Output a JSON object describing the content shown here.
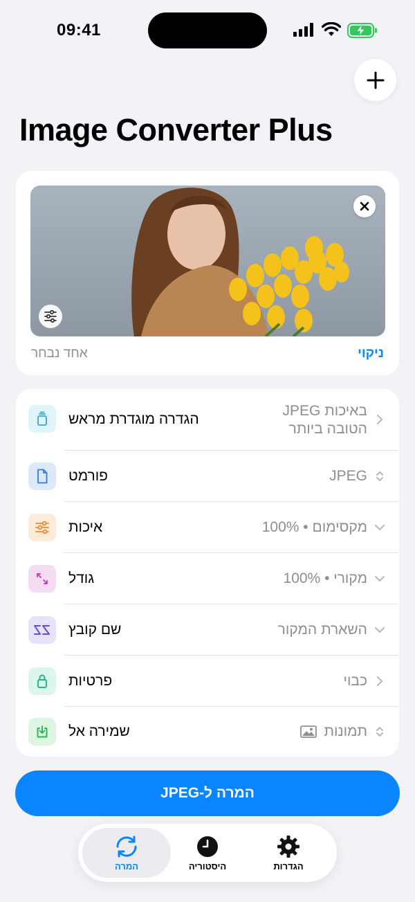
{
  "status_bar": {
    "time": "09:41"
  },
  "header": {
    "title": "Image Converter Plus"
  },
  "image_card": {
    "clear_label": "ניקוי",
    "selected_label": "אחד נבחר"
  },
  "settings": [
    {
      "label": "הגדרה מוגדרת מראש",
      "value_line1": "באיכות JPEG",
      "value_line2": "הטובה ביותר",
      "icon": "preset-icon",
      "chevron": "chevron-right"
    },
    {
      "label": "פורמט",
      "value": "JPEG",
      "icon": "document-icon",
      "chevron": "chevron-up-down"
    },
    {
      "label": "איכות",
      "value": "מקסימום • 100%",
      "icon": "sliders-icon",
      "chevron": "chevron-down"
    },
    {
      "label": "גודל",
      "value": "מקורי • 100%",
      "icon": "resize-icon",
      "chevron": "chevron-down"
    },
    {
      "label": "שם קובץ",
      "value": "השארת המקור",
      "icon": "text-icon",
      "chevron": "chevron-down"
    },
    {
      "label": "פרטיות",
      "value": "כבוי",
      "icon": "lock-icon",
      "chevron": "chevron-right"
    },
    {
      "label": "שמירה אל",
      "value": "תמונות",
      "icon": "download-icon",
      "chevron": "chevron-up-down"
    }
  ],
  "convert_button": {
    "label": "המרה ל-JPEG"
  },
  "tabs": [
    {
      "label": "המרה",
      "icon": "convert-icon",
      "active": true
    },
    {
      "label": "היסטוריה",
      "icon": "clock-icon",
      "active": false
    },
    {
      "label": "הגדרות",
      "icon": "gear-icon",
      "active": false
    }
  ],
  "colors": {
    "accent": "#0a84ff",
    "background": "#f2f2f7"
  }
}
